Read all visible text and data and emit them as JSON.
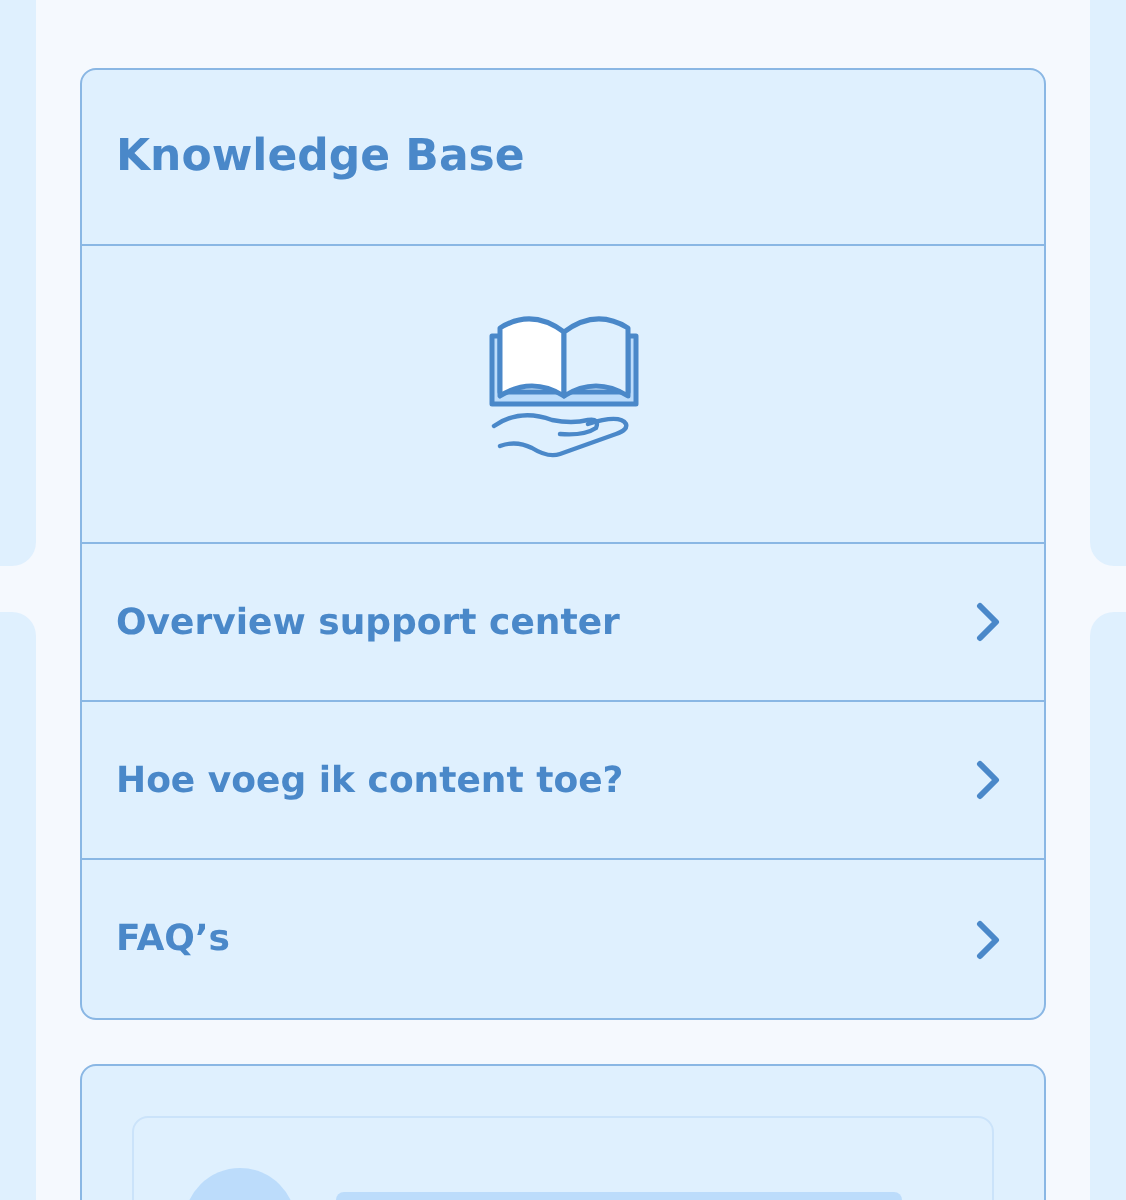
{
  "card": {
    "title": "Knowledge Base"
  },
  "links": [
    {
      "label": "Overview support center"
    },
    {
      "label": "Hoe voeg ik content toe?"
    },
    {
      "label": "FAQ’s"
    }
  ]
}
